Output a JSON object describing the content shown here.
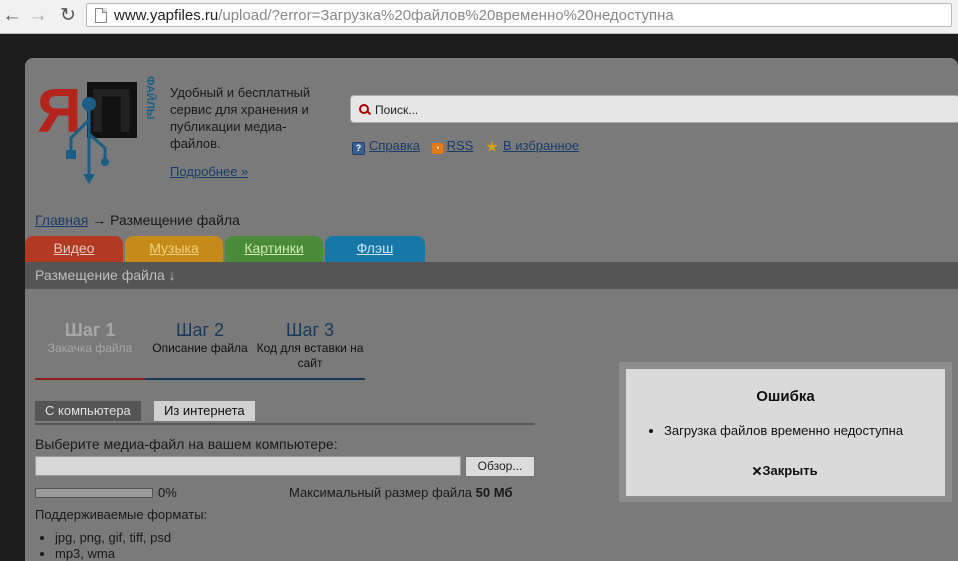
{
  "browser": {
    "url_host": "www.yapfiles.ru",
    "url_rest": "/upload/?error=Загрузка%20файлов%20временно%20недоступна"
  },
  "header": {
    "logo_letters": "ЯП",
    "logo_side_text": "ФАЙЛЫ",
    "tagline": "Удобный и бесплатный сервис для хранения и публикации медиа-файлов.",
    "more_link": "Подробнее »",
    "search_placeholder": "Поиск...",
    "links": {
      "help": "Справка",
      "rss": "RSS",
      "favorites": "В избранное"
    }
  },
  "breadcrumb": {
    "home": "Главная",
    "sep": " → ",
    "current": "Размещение файла"
  },
  "tabs": [
    {
      "label": "Видео",
      "color": "#b23a22",
      "text_color": "#e9c9c0"
    },
    {
      "label": "Музыка",
      "color": "#c58a1a",
      "text_color": "#f1d27a"
    },
    {
      "label": "Картинки",
      "color": "#4a8b3a",
      "text_color": "#cfe9b0"
    },
    {
      "label": "Флэш",
      "color": "#1778a8",
      "text_color": "#c8e6f5"
    }
  ],
  "section_bar": "Размещение файла ↓",
  "steps": [
    {
      "num": "Шаг 1",
      "desc": "Закачка файла"
    },
    {
      "num": "Шаг 2",
      "desc": "Описание файла"
    },
    {
      "num": "Шаг 3",
      "desc": "Код для вставки на сайт"
    }
  ],
  "upload": {
    "source_tabs": [
      "С компьютера",
      "Из интернета"
    ],
    "choose_label": "Выберите медиа-файл на вашем компьютере:",
    "browse_label": "Обзор...",
    "progress_percent": 0,
    "progress_text": "0%",
    "max_size_label": "Максимальный размер файла ",
    "max_size_value": "50 Мб",
    "formats_title": "Поддерживаемые форматы:",
    "formats": [
      "jpg, png, gif, tiff, psd",
      "mp3, wma"
    ]
  },
  "modal": {
    "title": "Ошибка",
    "message": "Загрузка файлов временно недоступна",
    "close_label": "Закрыть"
  }
}
